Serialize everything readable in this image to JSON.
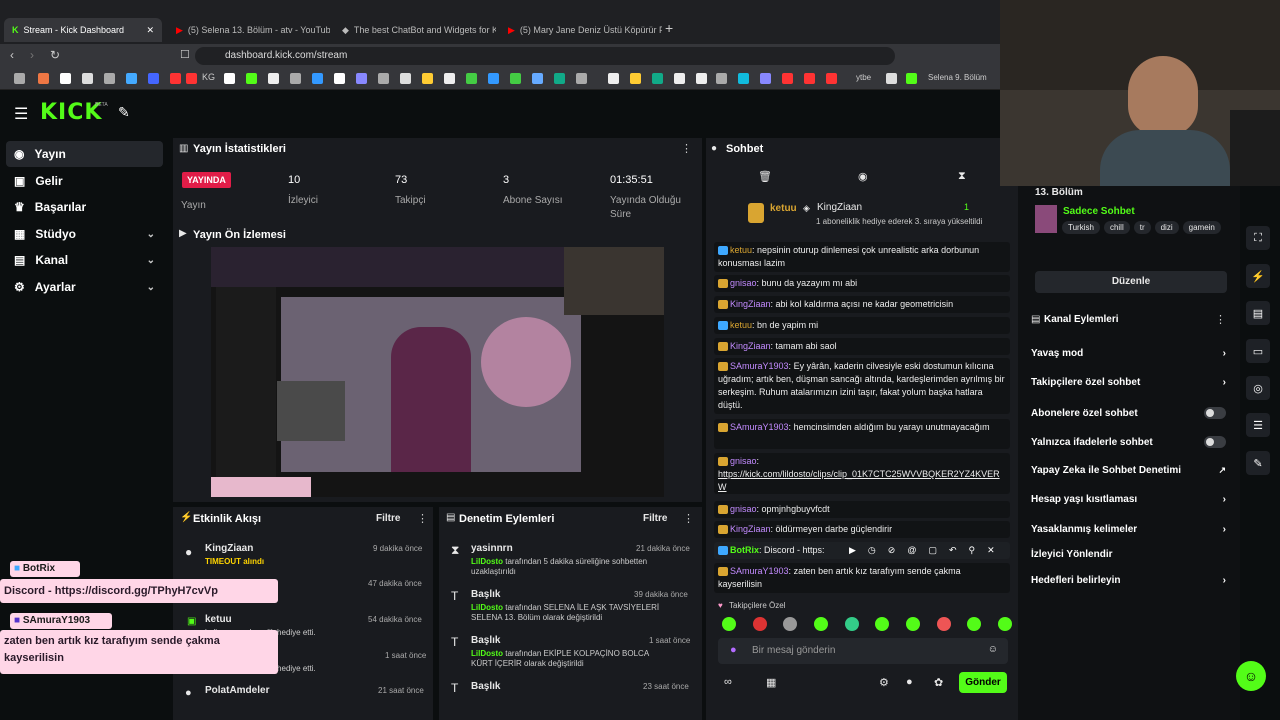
{
  "browser": {
    "tabs": [
      "Stream - Kick Dashboard",
      "(5) Selena 13. Bölüm - atv - YouTube",
      "The best ChatBot and Widgets for Ki",
      "(5) Mary Jane Deniz Üstü Köpürür Fu"
    ],
    "url": "dashboard.kick.com/stream",
    "bookmark_labels": [
      "KG",
      "ytbe",
      "Selena 9. Bölüm"
    ]
  },
  "kick": {
    "logo": "KICK",
    "beta": "BETA"
  },
  "sidebar": {
    "items": [
      {
        "label": "Yayın",
        "icon": "broadcast-icon"
      },
      {
        "label": "Gelir",
        "icon": "money-icon"
      },
      {
        "label": "Başarılar",
        "icon": "trophy-icon"
      },
      {
        "label": "Stüdyo",
        "icon": "studio-icon"
      },
      {
        "label": "Kanal",
        "icon": "channel-icon"
      },
      {
        "label": "Ayarlar",
        "icon": "gear-icon"
      }
    ]
  },
  "stats": {
    "title": "Yayın İstatistikleri",
    "live_badge": "YAYINDA",
    "live_label": "Yayın",
    "viewers_val": "10",
    "viewers_lbl": "İzleyici",
    "followers_val": "73",
    "followers_lbl": "Takipçi",
    "subs_val": "3",
    "subs_lbl": "Abone Sayısı",
    "uptime_val": "01:35:51",
    "uptime_lbl1": "Yayında Olduğu",
    "uptime_lbl2": "Süre"
  },
  "preview": {
    "title": "Yayın Ön İzlemesi"
  },
  "activity": {
    "title": "Etkinlik Akışı",
    "filter": "Filtre",
    "items": [
      {
        "name": "KingZiaan",
        "sub": "TIMEOUT alındı",
        "time": "9 dakika önce"
      },
      {
        "name": "",
        "sub": "",
        "time": "47 dakika önce"
      },
      {
        "name": "ketuu",
        "sub": "kullanıcıya abonelik hediye etti.",
        "time": "54 dakika önce"
      },
      {
        "name": "",
        "sub": "kullanıcıya abonelik hediye etti.",
        "time": "1 saat önce"
      },
      {
        "name": "PolatAmdeler",
        "sub": "",
        "time": "21 saat önce"
      }
    ]
  },
  "moderation": {
    "title": "Denetim Eylemleri",
    "filter": "Filtre",
    "items": [
      {
        "title": "yasinnrn",
        "user": "LilDosto",
        "text": "tarafından 5 dakika süreliğine sohbetten uzaklaştırıldı",
        "time": "21 dakika önce"
      },
      {
        "title": "Başlık",
        "user": "LilDosto",
        "text": "tarafından SELENA İLE AŞK TAVSİYELERİ SELENA 13. Bölüm olarak değiştirildi",
        "time": "39 dakika önce"
      },
      {
        "title": "Başlık",
        "user": "LilDosto",
        "text": "tarafından EKİPLE KOLPAÇİNO BOLCA KÜRT İÇERİR olarak değiştirildi",
        "time": "1 saat önce"
      },
      {
        "title": "Başlık",
        "user": "",
        "text": "",
        "time": "23 saat önce"
      }
    ]
  },
  "chat": {
    "title": "Sohbet",
    "pinned_user1": "ketuu",
    "pinned_user2": "KingZiaan",
    "pinned_count": "1",
    "pinned_text": "1 aboneliklik hediye ederek 3. sıraya yükseltildi",
    "messages": [
      {
        "user": "ketuu",
        "text": "nepsinin oturup dinlemesi çok unrealistic arka dorbunun konusması lazim"
      },
      {
        "user": "gnisao",
        "text": "bunu da yazayım mı abi"
      },
      {
        "user": "KingZiaan",
        "text": "abi kol kaldırma açısı ne kadar geometricisin"
      },
      {
        "user": "ketuu",
        "text": "bn de yapim mi"
      },
      {
        "user": "KingZiaan",
        "text": "tamam abi saol"
      },
      {
        "user": "SAmuraY1903",
        "text": "Ey yârân, kaderin cilvesiyle eski dostumun kılıcına uğradım; artık ben, düşman sancağı altında, kardeşlerimden ayrılmış bir serkeşim. Ruhum atalarımızın izini taşır, fakat yolum başka hatlara düştü."
      },
      {
        "user": "SAmuraY1903",
        "text": "hemcinsimden aldığım bu yarayı unutmayacağım"
      },
      {
        "user": "gnisao",
        "text": "https://kick.com/lildosto/clips/clip_01K7CTC25WVVBQKER2YZ4KVERW"
      },
      {
        "user": "gnisao",
        "text": "opmjnhgbuyvfcdt"
      },
      {
        "user": "KingZiaan",
        "text": "öldürmeyen darbe güçlendirir"
      },
      {
        "user": "BotRix",
        "text": "Discord - https:"
      },
      {
        "user": "SAmuraY1903",
        "text": "zaten ben artık kız tarafıyım sende çakma kayserilisin"
      }
    ],
    "emote_label": "Takipçilere Özel",
    "input_placeholder": "Bir mesaj gönderin",
    "send": "Gönder"
  },
  "channel": {
    "episode": "13. Bölüm",
    "category": "Sadece Sohbet",
    "tags": [
      "Turkish",
      "chill",
      "tr",
      "dizi",
      "gamein"
    ],
    "edit": "Düzenle",
    "events_title": "Kanal Eylemleri",
    "items": [
      {
        "label": "Yavaş mod",
        "ctrl": "arrow"
      },
      {
        "label": "Takipçilere özel sohbet",
        "ctrl": "arrow"
      },
      {
        "label": "Abonelere özel sohbet",
        "ctrl": "toggle"
      },
      {
        "label": "Yalnızca ifadelerle sohbet",
        "ctrl": "toggle"
      },
      {
        "label": "Yapay Zeka ile Sohbet Denetimi",
        "ctrl": "ext"
      },
      {
        "label": "Hesap yaşı kısıtlaması",
        "ctrl": "arrow"
      },
      {
        "label": "Yasaklanmış kelimeler",
        "ctrl": "arrow"
      },
      {
        "label": "İzleyici Yönlendir",
        "ctrl": "none"
      },
      {
        "label": "Hedefleri belirleyin",
        "ctrl": "arrow"
      }
    ]
  },
  "overlay": {
    "user1": "BotRix",
    "msg1": "Discord - https://discord.gg/TPhyH7cvVp",
    "user2": "SAmuraY1903",
    "msg2": "zaten ben artık kız tarafıyım sende çakma kayserilisin"
  },
  "colors": {
    "accent": "#53fc18",
    "panel": "#191b1f",
    "live": "#e11d48"
  }
}
